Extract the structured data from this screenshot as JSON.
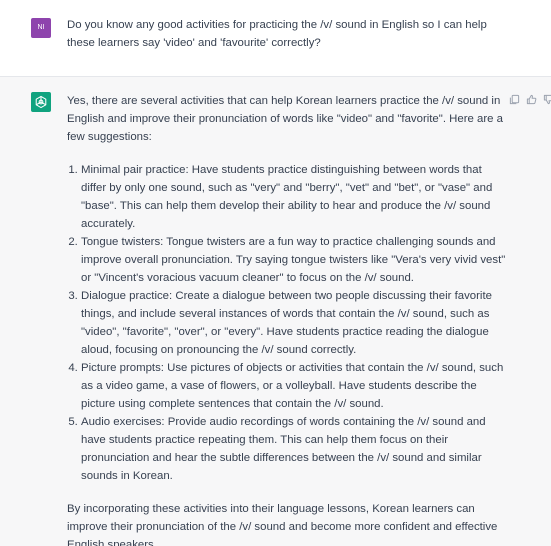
{
  "user": {
    "avatar_initials": "NI",
    "avatar_color": "#8e44ad",
    "message": "Do you know any good activities for practicing the /v/ sound in English so I can help these learners say 'video' and 'favourite' correctly?"
  },
  "assistant": {
    "avatar_color": "#10a37f",
    "avatar_icon": "openai-logo-icon",
    "actions": [
      "copy-icon",
      "thumbs-up-icon",
      "thumbs-down-icon"
    ],
    "intro": "Yes, there are several activities that can help Korean learners practice the /v/ sound in English and improve their pronunciation of words like \"video\" and \"favorite\". Here are a few suggestions:",
    "items": [
      "Minimal pair practice: Have students practice distinguishing between words that differ by only one sound, such as \"very\" and \"berry\", \"vet\" and \"bet\", or \"vase\" and \"base\". This can help them develop their ability to hear and produce the /v/ sound accurately.",
      "Tongue twisters: Tongue twisters are a fun way to practice challenging sounds and improve overall pronunciation. Try saying tongue twisters like \"Vera's very vivid vest\" or \"Vincent's voracious vacuum cleaner\" to focus on the /v/ sound.",
      "Dialogue practice: Create a dialogue between two people discussing their favorite things, and include several instances of words that contain the /v/ sound, such as \"video\", \"favorite\", \"over\", or \"every\". Have students practice reading the dialogue aloud, focusing on pronouncing the /v/ sound correctly.",
      "Picture prompts: Use pictures of objects or activities that contain the /v/ sound, such as a video game, a vase of flowers, or a volleyball. Have students describe the picture using complete sentences that contain the /v/ sound.",
      "Audio exercises: Provide audio recordings of words containing the /v/ sound and have students practice repeating them. This can help them focus on their pronunciation and hear the subtle differences between the /v/ sound and similar sounds in Korean."
    ],
    "conclusion": "By incorporating these activities into their language lessons, Korean learners can improve their pronunciation of the /v/ sound and become more confident and effective English speakers."
  }
}
